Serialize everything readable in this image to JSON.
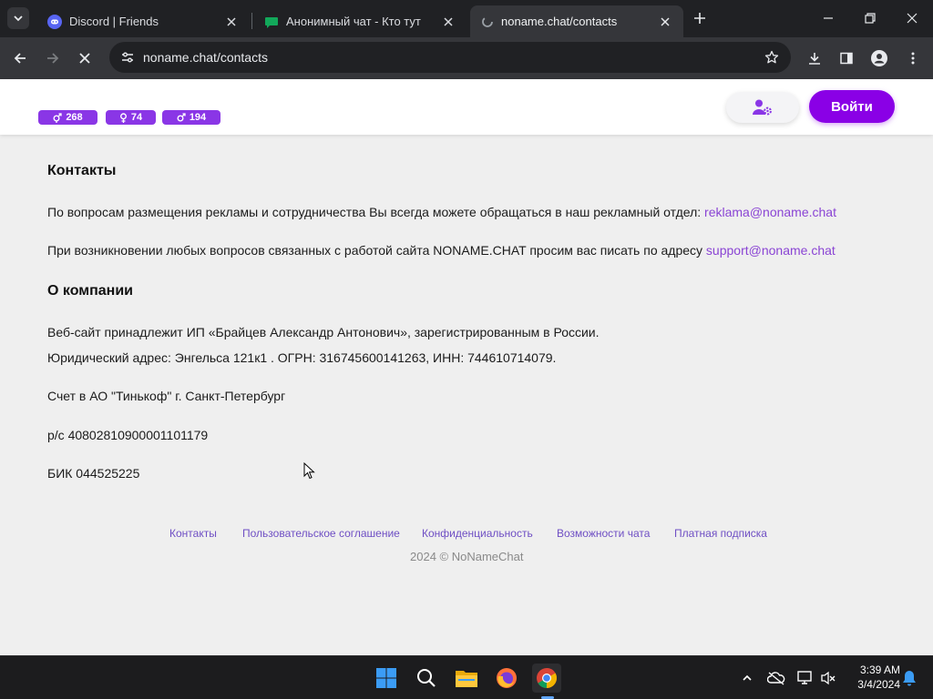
{
  "browser": {
    "tabs": [
      {
        "title": "Discord | Friends",
        "icon": "discord-icon"
      },
      {
        "title": "Анонимный чат - Кто тут",
        "icon": "chat-bubble-icon"
      },
      {
        "title": "noname.chat/contacts",
        "icon": "loading-icon",
        "active": true
      }
    ],
    "url": "noname.chat/contacts"
  },
  "site": {
    "stats": [
      {
        "icon": "gender-neutral-icon",
        "value": "268"
      },
      {
        "icon": "female-icon",
        "value": "74"
      },
      {
        "icon": "male-icon",
        "value": "194"
      }
    ],
    "login_label": "Войти",
    "accent_color": "#8a00e6"
  },
  "content": {
    "contacts_heading": "Контакты",
    "ads_text": "По вопросам размещения рекламы и сотрудничества Вы всегда можете обращаться в наш рекламный отдел: ",
    "ads_email": "reklama@noname.chat",
    "support_text": "При возникновении любых вопросов связанных с работой сайта NONAME.CHAT просим вас писать по адресу ",
    "support_email": "support@noname.chat",
    "company_heading": "О компании",
    "owner_text": "Веб-сайт принадлежит ИП «Брайцев Александр Антонович», зарегистрированным в России.",
    "legal_text": "Юридический адрес: Энгельса 121к1 . ОГРН: 316745600141263, ИНН: 744610714079.",
    "bank_text": "Счет в АО \"Тинькоф\" г. Санкт-Петербург",
    "account_text": "р/с 40802810900001101179",
    "bik_text": "БИК 044525225"
  },
  "footer": {
    "links": [
      "Контакты",
      "Пользовательское соглашение",
      "Конфиденциальность",
      "Возможности чата",
      "Платная подписка"
    ],
    "copyright": "2024 © NoNameChat"
  },
  "taskbar": {
    "time": "3:39 AM",
    "date": "3/4/2024"
  }
}
